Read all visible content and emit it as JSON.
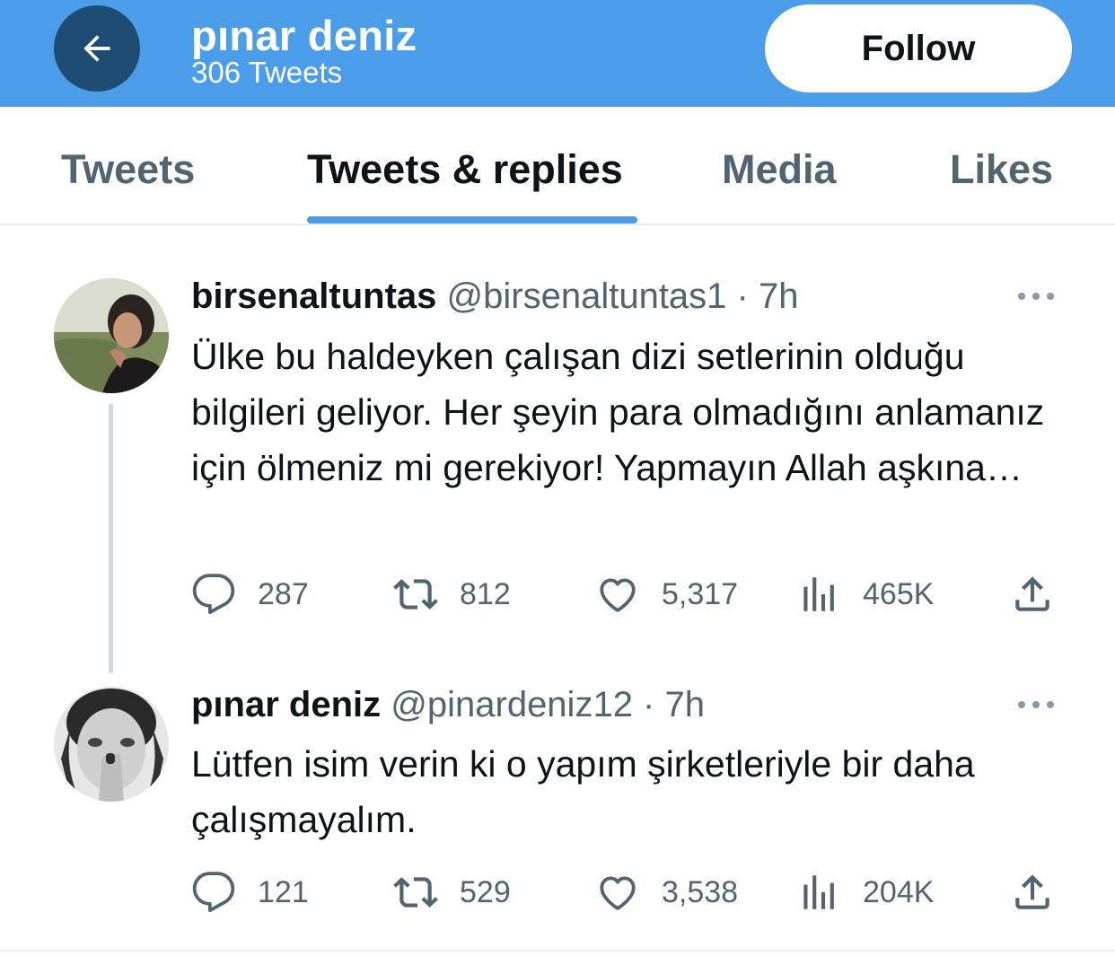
{
  "header": {
    "name": "pınar deniz",
    "tweet_count": "306 Tweets",
    "follow_label": "Follow"
  },
  "tabs": [
    {
      "label": "Tweets",
      "active": false
    },
    {
      "label": "Tweets & replies",
      "active": true
    },
    {
      "label": "Media",
      "active": false
    },
    {
      "label": "Likes",
      "active": false
    }
  ],
  "tweets": [
    {
      "author": "birsenaltuntas",
      "meta": "@birsenaltuntas1 · 7h",
      "text": "Ülke bu haldeyken çalışan dizi setlerinin olduğu bilgileri geliyor. Her şeyin para olmadığını anlamanız için ölmeniz mi gerekiyor! Yapmayın Allah aşkına…",
      "replies": "287",
      "retweets": "812",
      "likes": "5,317",
      "views": "465K"
    },
    {
      "author": "pınar deniz",
      "meta": "@pinardeniz12 · 7h",
      "text": "Lütfen isim verin ki o yapım şirketleriyle bir daha çalışmayalım.",
      "replies": "121",
      "retweets": "529",
      "likes": "3,538",
      "views": "204K"
    }
  ],
  "icons": {
    "back": "arrow-left-icon",
    "more": "more-horizontal-icon",
    "reply": "reply-bubble-icon",
    "retweet": "retweet-icon",
    "like": "heart-icon",
    "views": "views-bar-icon",
    "share": "share-upload-icon"
  },
  "colors": {
    "header_bg": "#4c9de9",
    "back_button_bg": "#1f4c73",
    "tab_indicator": "#4c9de9",
    "secondary_text": "#536471"
  }
}
